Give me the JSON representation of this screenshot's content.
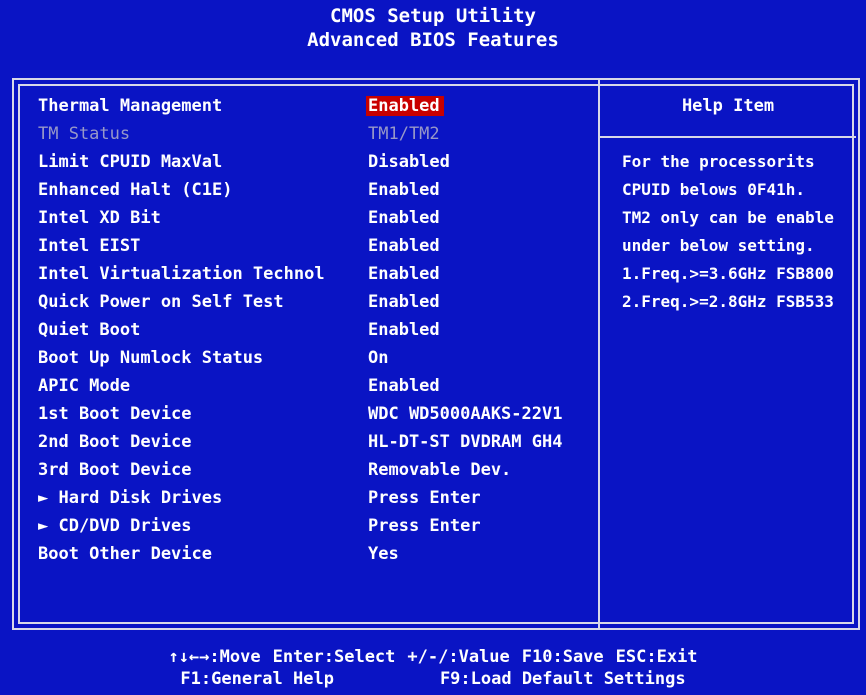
{
  "header": {
    "title": "CMOS Setup Utility",
    "subtitle": "Advanced BIOS Features"
  },
  "settings": [
    {
      "label": "Thermal Management",
      "value": "Enabled",
      "selected": true,
      "disabled": false
    },
    {
      "label": "TM Status",
      "value": "TM1/TM2",
      "selected": false,
      "disabled": true
    },
    {
      "label": "Limit CPUID MaxVal",
      "value": "Disabled",
      "selected": false,
      "disabled": false
    },
    {
      "label": "Enhanced Halt (C1E)",
      "value": "Enabled",
      "selected": false,
      "disabled": false
    },
    {
      "label": "Intel XD Bit",
      "value": "Enabled",
      "selected": false,
      "disabled": false
    },
    {
      "label": "Intel EIST",
      "value": "Enabled",
      "selected": false,
      "disabled": false
    },
    {
      "label": "Intel Virtualization Technol",
      "value": "Enabled",
      "selected": false,
      "disabled": false
    },
    {
      "label": "Quick Power on Self Test",
      "value": "Enabled",
      "selected": false,
      "disabled": false
    },
    {
      "label": "Quiet Boot",
      "value": "Enabled",
      "selected": false,
      "disabled": false
    },
    {
      "label": "Boot Up Numlock Status",
      "value": "On",
      "selected": false,
      "disabled": false
    },
    {
      "label": "APIC Mode",
      "value": "Enabled",
      "selected": false,
      "disabled": false
    },
    {
      "label": "1st Boot Device",
      "value": "WDC WD5000AAKS-22V1",
      "selected": false,
      "disabled": false
    },
    {
      "label": "2nd Boot Device",
      "value": "HL-DT-ST DVDRAM GH4",
      "selected": false,
      "disabled": false
    },
    {
      "label": "3rd Boot Device",
      "value": "Removable Dev.",
      "selected": false,
      "disabled": false
    },
    {
      "label": "► Hard Disk Drives",
      "value": "Press Enter",
      "selected": false,
      "disabled": false
    },
    {
      "label": "► CD/DVD Drives",
      "value": "Press Enter",
      "selected": false,
      "disabled": false
    },
    {
      "label": "Boot Other Device",
      "value": "Yes",
      "selected": false,
      "disabled": false
    }
  ],
  "help": {
    "title": "Help Item",
    "lines": [
      "For the processorits",
      "CPUID belows 0F41h.",
      "TM2 only can be enable",
      "under below setting.",
      "1.Freq.>=3.6GHz FSB800",
      "2.Freq.>=2.8GHz FSB533"
    ]
  },
  "footer": {
    "line1": [
      "↑↓←→:Move",
      "Enter:Select",
      "+/-/:Value",
      "F10:Save",
      "ESC:Exit"
    ],
    "line2": [
      "F1:General Help",
      "F9:Load Default Settings"
    ]
  },
  "colors": {
    "background": "#0a14c4",
    "selection": "#c80000",
    "disabled_text": "#9898c8",
    "frame": "#d8d8e8"
  }
}
